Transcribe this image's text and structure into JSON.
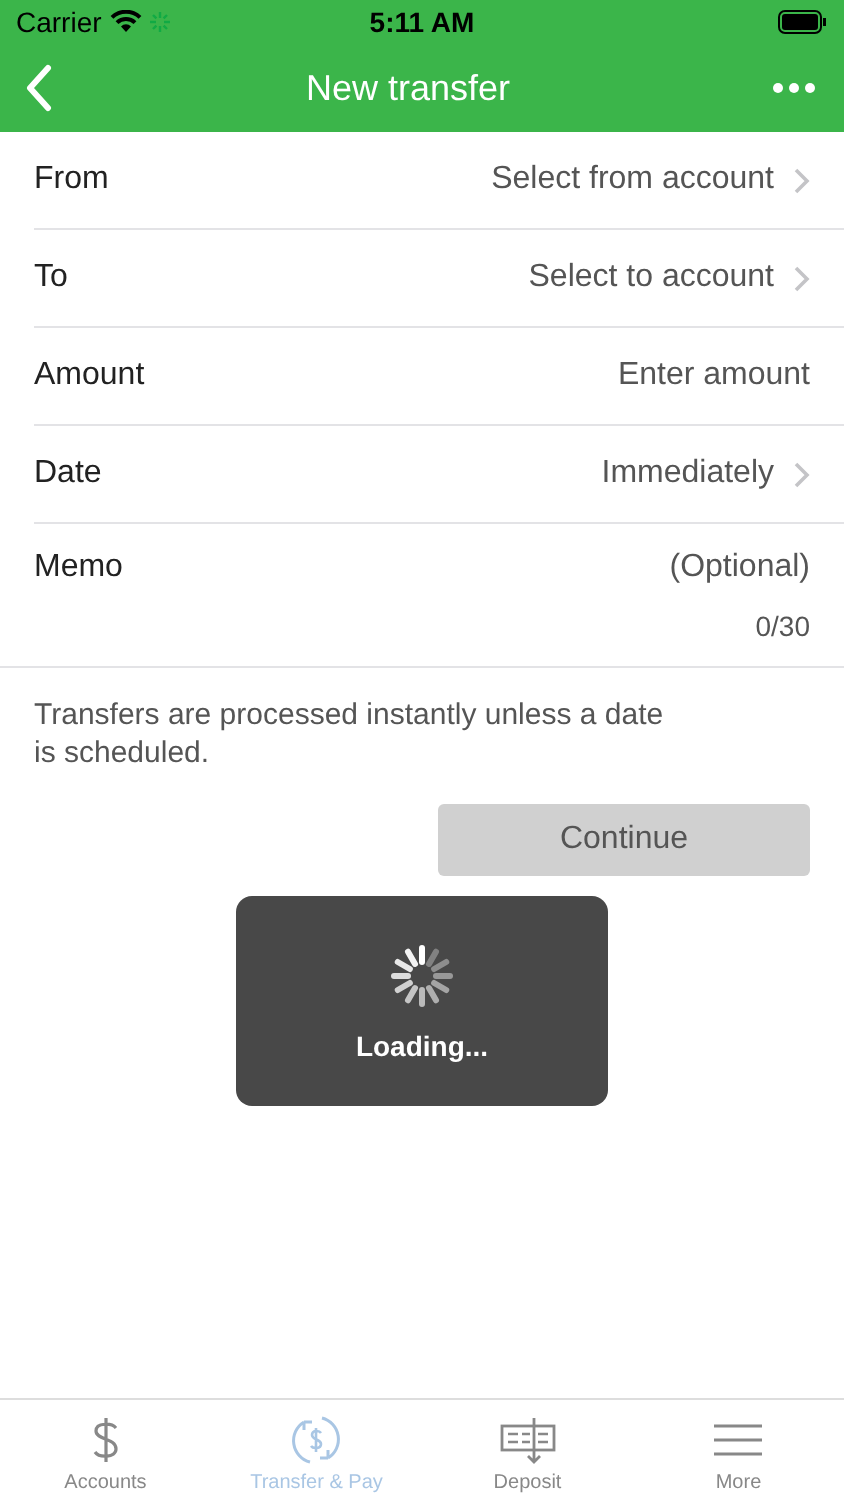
{
  "status_bar": {
    "carrier": "Carrier",
    "time": "5:11 AM"
  },
  "nav": {
    "title": "New transfer"
  },
  "rows": [
    {
      "kind": "select",
      "label": "From",
      "value": "Select from account"
    },
    {
      "kind": "select",
      "label": "To",
      "value": "Select to account"
    },
    {
      "kind": "input",
      "label": "Amount",
      "placeholder": "Enter amount"
    },
    {
      "kind": "select",
      "label": "Date",
      "value": "Immediately"
    },
    {
      "kind": "memo",
      "label": "Memo",
      "placeholder": "(Optional)",
      "counter": "0/30"
    }
  ],
  "note": "Transfers are processed instantly unless a date is scheduled.",
  "continue_button": {
    "label": "Continue",
    "disabled": true
  },
  "hud": {
    "label": "Loading..."
  },
  "tabs": [
    {
      "kind": "dollar",
      "label": "Accounts",
      "selected": false
    },
    {
      "kind": "transfer",
      "label": "Transfer & Pay",
      "selected": true
    },
    {
      "kind": "deposit",
      "label": "Deposit",
      "selected": false
    },
    {
      "kind": "menu",
      "label": "More",
      "selected": false
    }
  ]
}
